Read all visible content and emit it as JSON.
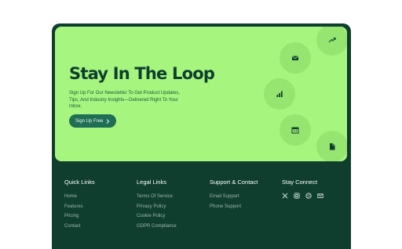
{
  "hero": {
    "title": "Stay In The Loop",
    "description": "Sign Up For Our Newsletter To Get Product Updates, Tips, And Industry Insights—Delivered Right To Your Inbox.",
    "cta_label": "Sign Up Free",
    "cta_icon": "chevron-right-icon"
  },
  "floating_icons": [
    "trending-up-icon",
    "mail-icon",
    "bar-chart-icon",
    "calendar-icon",
    "document-icon"
  ],
  "footer": {
    "quick_links": {
      "heading": "Quick Links",
      "items": [
        "Home",
        "Features",
        "Pricing",
        "Contact"
      ]
    },
    "legal_links": {
      "heading": "Legal Links",
      "items": [
        "Terms Of Service",
        "Privacy Policy",
        "Cookie Policy",
        "GDPR Compliance"
      ]
    },
    "support": {
      "heading": "Support & Contact",
      "items": [
        "Email Support",
        "Phone Support"
      ]
    },
    "connect": {
      "heading": "Stay Connect",
      "icons": [
        "x-icon",
        "instagram-icon",
        "dribbble-icon",
        "mail-icon"
      ]
    }
  },
  "colors": {
    "dark_green": "#0f3d2e",
    "lime": "#a6f57f",
    "button": "#1f6e56"
  }
}
